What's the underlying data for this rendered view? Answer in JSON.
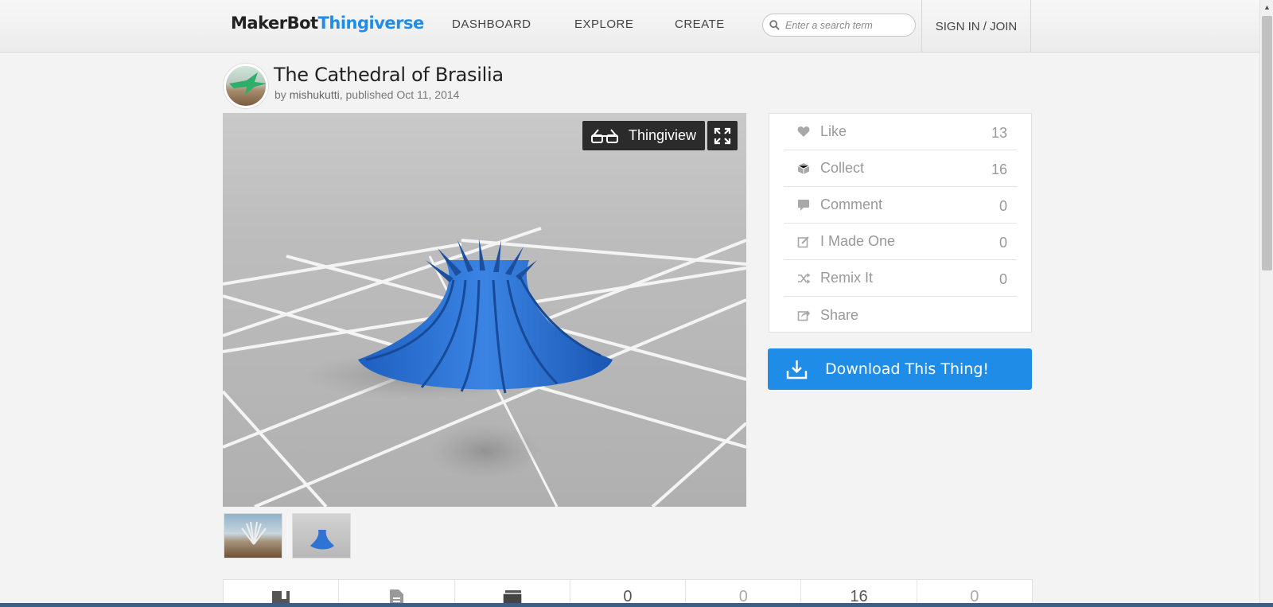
{
  "header": {
    "logo_makerbot": "MakerBot",
    "logo_thingiverse": "Thingiverse",
    "nav": [
      "DASHBOARD",
      "EXPLORE",
      "CREATE"
    ],
    "search_placeholder": "Enter a search term",
    "signin": "SIGN IN / JOIN"
  },
  "thing": {
    "title": "The Cathedral of Brasilia",
    "by": "by",
    "author": "mishukutti",
    "published": ", published Oct 11, 2014"
  },
  "viewer": {
    "thingiview_label": "Thingiview"
  },
  "actions": [
    {
      "label": "Like",
      "count": "13",
      "icon": "heart-icon"
    },
    {
      "label": "Collect",
      "count": "16",
      "icon": "collect-box-icon"
    },
    {
      "label": "Comment",
      "count": "0",
      "icon": "comment-icon"
    },
    {
      "label": "I Made One",
      "count": "0",
      "icon": "made-one-icon"
    },
    {
      "label": "Remix It",
      "count": "0",
      "icon": "remix-icon"
    },
    {
      "label": "Share",
      "count": "",
      "icon": "share-icon"
    }
  ],
  "download_label": "Download This Thing!",
  "tabs": [
    "",
    "",
    "",
    "0",
    "0",
    "16",
    "0"
  ],
  "colors": {
    "accent": "#1f8de8",
    "model_blue": "#2f74d4"
  }
}
